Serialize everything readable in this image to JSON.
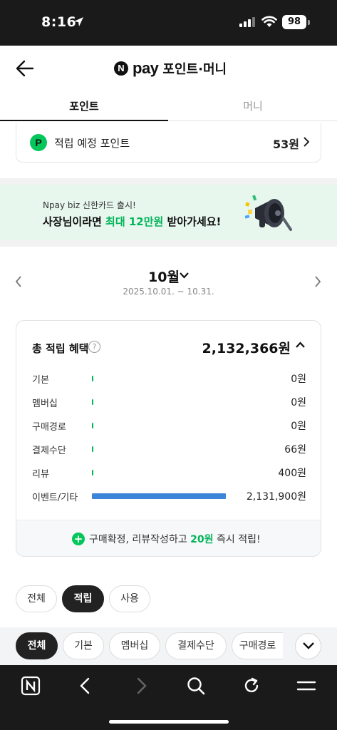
{
  "status": {
    "time": "8:16",
    "battery": "98"
  },
  "header": {
    "pay_logo_letter": "N",
    "pay_logo_text": "pay",
    "title": "포인트·머니"
  },
  "tabs": [
    {
      "label": "포인트"
    },
    {
      "label": "머니"
    }
  ],
  "pending": {
    "badge": "P",
    "label": "적립 예정 포인트",
    "value": "53원"
  },
  "banner": {
    "subtitle": "Npay biz 신한카드 출시!",
    "main_pre": "사장님이라면 ",
    "main_highlight": "최대 12만원",
    "main_post": " 받아가세요!"
  },
  "month": {
    "label": "10월",
    "range": "2025.10.01. ~ 10.31."
  },
  "summary": {
    "title": "총 적립 혜택",
    "help": "?",
    "total": "2,132,366원",
    "rows": [
      {
        "label": "기본",
        "value": "0원",
        "share": 0
      },
      {
        "label": "멤버십",
        "value": "0원",
        "share": 0
      },
      {
        "label": "구매경로",
        "value": "0원",
        "share": 0
      },
      {
        "label": "결제수단",
        "value": "66원",
        "share": 3e-05
      },
      {
        "label": "리뷰",
        "value": "400원",
        "share": 0.0002
      },
      {
        "label": "이벤트/기타",
        "value": "2,131,900원",
        "share": 1.0
      }
    ],
    "footer": {
      "pre": "구매확정, 리뷰작성하고 ",
      "highlight": "20원",
      "post": " 즉시 적립!"
    }
  },
  "type_filters": [
    {
      "label": "전체"
    },
    {
      "label": "적립"
    },
    {
      "label": "사용"
    }
  ],
  "category_filters": [
    {
      "label": "전체"
    },
    {
      "label": "기본"
    },
    {
      "label": "멤버십"
    },
    {
      "label": "결제수단"
    },
    {
      "label": "구매경로"
    }
  ],
  "colors": {
    "accent_green": "#03c75a",
    "bar_blue": "#3d85d8",
    "dark": "#222222"
  },
  "icons": {
    "nav": [
      "naver-home-icon",
      "back-arrow-icon",
      "forward-arrow-icon",
      "search-icon",
      "refresh-icon",
      "menu-icon"
    ]
  }
}
